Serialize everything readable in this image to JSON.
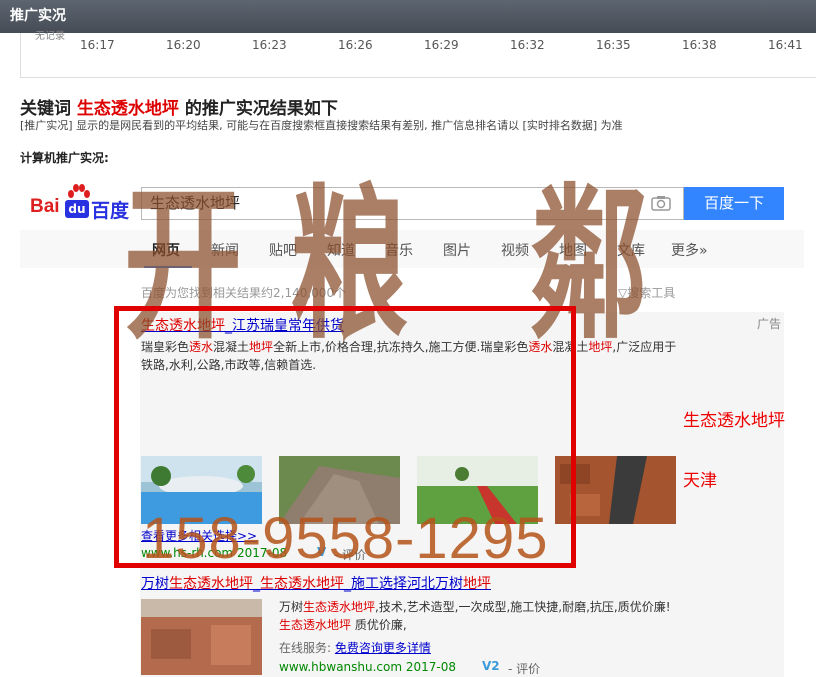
{
  "header": {
    "title": "推广实况"
  },
  "timeline": {
    "cut_label": "无记录",
    "ticks": [
      "16:17",
      "16:20",
      "16:23",
      "16:26",
      "16:29",
      "16:32",
      "16:35",
      "16:38",
      "16:41"
    ]
  },
  "headline": {
    "prefix": "关键词 ",
    "keyword": "生态透水地坪",
    "suffix": " 的推广实况结果如下"
  },
  "note": "[推广实况] 显示的是网民看到的平均结果, 可能与在百度搜索框直接搜索结果有差别, 推广信息排名请以 [实时排名数据] 为准",
  "pc_label": "计算机推广实况:",
  "baidu": {
    "logo_bai": "Bai",
    "logo_du": "du",
    "logo_name": "百度",
    "query": "生态透水地坪",
    "button": "百度一下",
    "tabs": [
      "网页",
      "新闻",
      "贴吧",
      "知道",
      "音乐",
      "图片",
      "视频",
      "地图",
      "文库",
      "更多»"
    ],
    "result_count": "百度为您找到相关结果约2,140,000个",
    "tools": "搜索工具",
    "ad_label": "广告"
  },
  "ad1": {
    "title_parts": [
      "生态透水地坪",
      "_江苏瑞皇常年供货"
    ],
    "desc_parts": [
      "瑞皇彩色",
      "透水",
      "混凝土",
      "地坪",
      "全新上市,价格合理,抗冻持久,施工方便.瑞皇彩色",
      "透水",
      "混凝土",
      "地坪",
      ",广泛应用于铁路,水利,公路,市政等,信赖首选."
    ],
    "more_link": "查看更多相关选择>>",
    "url": "www.hs-rh.com",
    "date": "2017-08",
    "badge": "V",
    "review": "- 评价"
  },
  "ad2": {
    "title_parts": [
      "万树",
      "生态透水地坪",
      "_",
      "生态透水地坪",
      "_施工选择河北万树",
      "地坪"
    ],
    "desc_parts": [
      "万树",
      "生态透水地坪",
      ",技术,艺术造型,一次成型,施工快捷,耐磨,抗压,质优价廉!",
      "生态透水地坪",
      " 质优价廉,"
    ],
    "service_label": "在线服务:",
    "service_link": "免费咨询更多详情",
    "url": "www.hbwanshu.com",
    "date": "2017-08",
    "badge": "V2",
    "review": "- 评价"
  },
  "overlay": {
    "watermark_chars": [
      "开",
      "粮",
      "鄰"
    ],
    "phone": "158-9558-1295",
    "side_keyword": "生态透水地坪",
    "side_city": "天津"
  },
  "colors": {
    "frame": "#e00000",
    "link": "#0000cc",
    "keyword": "#dd0000",
    "button": "#3385ff",
    "url": "#008000"
  }
}
